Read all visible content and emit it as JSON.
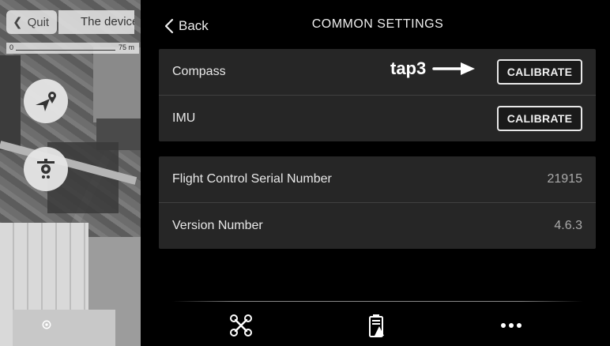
{
  "map": {
    "quit_label": "Quit",
    "device_title": "The device",
    "scale_zero": "0",
    "scale_max": "75 m",
    "buttons": [
      {
        "icon": "send-location-icon"
      },
      {
        "icon": "drone-camera-icon"
      }
    ],
    "locate_icon": "target-icon"
  },
  "header": {
    "back_label": "Back",
    "title": "COMMON SETTINGS"
  },
  "calibration": {
    "rows": [
      {
        "label": "Compass",
        "button": "CALIBRATE"
      },
      {
        "label": "IMU",
        "button": "CALIBRATE"
      }
    ]
  },
  "info": {
    "rows": [
      {
        "label": "Flight Control Serial Number",
        "value": "21915"
      },
      {
        "label": "Version Number",
        "value": "4.6.3"
      }
    ]
  },
  "annotation": {
    "text": "tap3",
    "icon": "arrow-right-icon"
  },
  "tabbar": {
    "items": [
      {
        "icon": "drone-icon"
      },
      {
        "icon": "battery-icon"
      },
      {
        "icon": "more-icon"
      }
    ]
  },
  "colors": {
    "background": "#000000",
    "group_bg": "#262626",
    "text": "#e8e8e8",
    "value_text": "#aaaaaa"
  }
}
